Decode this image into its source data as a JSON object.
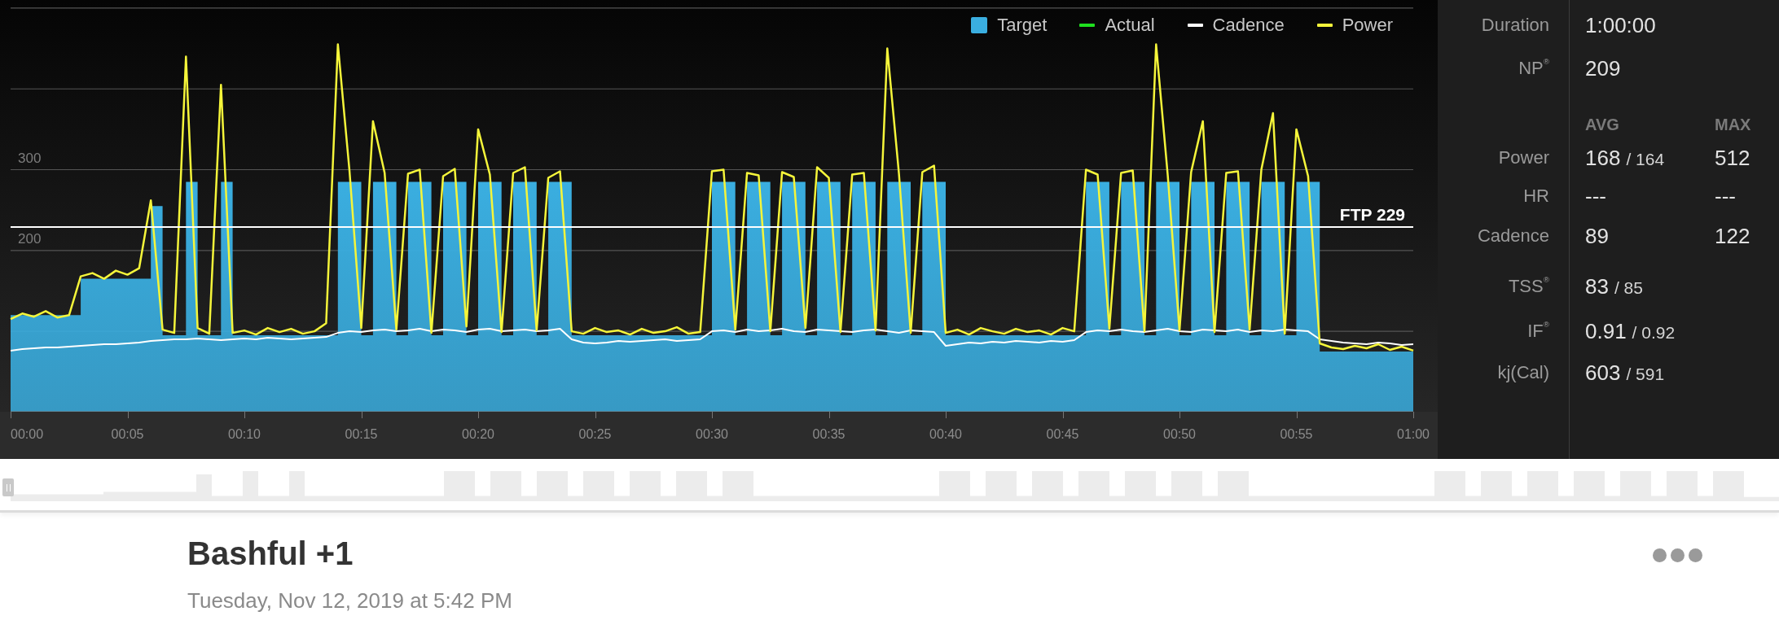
{
  "chart": {
    "chart_data": {
      "type": "area",
      "legend": "upper right",
      "ylim": [
        -58,
        510
      ],
      "xlim": [
        0,
        60
      ],
      "yticks": [
        200,
        300
      ],
      "xticks": [
        {
          "value": 0,
          "label": "00:00"
        },
        {
          "value": 5,
          "label": "00:05"
        },
        {
          "value": 10,
          "label": "00:10"
        },
        {
          "value": 15,
          "label": "00:15"
        },
        {
          "value": 20,
          "label": "00:20"
        },
        {
          "value": 25,
          "label": "00:25"
        },
        {
          "value": 30,
          "label": "00:30"
        },
        {
          "value": 35,
          "label": "00:35"
        },
        {
          "value": 40,
          "label": "00:40"
        },
        {
          "value": 45,
          "label": "00:45"
        },
        {
          "value": 50,
          "label": "00:50"
        },
        {
          "value": 55,
          "label": "00:55"
        },
        {
          "value": 60,
          "label": "01:00"
        }
      ],
      "x": [
        0,
        0.5,
        1,
        1.5,
        2,
        2.5,
        3,
        3.5,
        4,
        4.5,
        5,
        5.5,
        6,
        6.5,
        7,
        7.5,
        8,
        8.5,
        9,
        9.5,
        10,
        10.5,
        11,
        11.5,
        12,
        12.5,
        13,
        13.5,
        14,
        14.5,
        15,
        15.5,
        16,
        16.5,
        17,
        17.5,
        18,
        18.5,
        19,
        19.5,
        20,
        20.5,
        21,
        21.5,
        22,
        22.5,
        23,
        23.5,
        24,
        24.5,
        25,
        25.5,
        26,
        26.5,
        27,
        27.5,
        28,
        28.5,
        29,
        29.5,
        30,
        30.5,
        31,
        31.5,
        32,
        32.5,
        33,
        33.5,
        34,
        34.5,
        35,
        35.5,
        36,
        36.5,
        37,
        37.5,
        38,
        38.5,
        39,
        39.5,
        40,
        40.5,
        41,
        41.5,
        42,
        42.5,
        43,
        43.5,
        44,
        44.5,
        45,
        45.5,
        46,
        46.5,
        47,
        47.5,
        48,
        48.5,
        49,
        49.5,
        50,
        50.5,
        51,
        51.5,
        52,
        52.5,
        53,
        53.5,
        54,
        54.5,
        55,
        55.5,
        56,
        56.5,
        57,
        57.5,
        58,
        58.5,
        59,
        59.5,
        60
      ],
      "series": [
        {
          "name": "Target",
          "color": "#3aaee0",
          "values": [
            120,
            120,
            120,
            120,
            120,
            120,
            165,
            165,
            165,
            165,
            165,
            165,
            255,
            95,
            95,
            285,
            95,
            95,
            285,
            95,
            95,
            95,
            95,
            95,
            95,
            95,
            95,
            95,
            285,
            285,
            95,
            285,
            285,
            95,
            285,
            285,
            95,
            285,
            285,
            95,
            285,
            285,
            95,
            285,
            285,
            95,
            285,
            285,
            95,
            95,
            95,
            95,
            95,
            95,
            95,
            95,
            95,
            95,
            95,
            95,
            285,
            285,
            95,
            285,
            285,
            95,
            285,
            285,
            95,
            285,
            285,
            95,
            285,
            285,
            95,
            285,
            285,
            95,
            285,
            285,
            95,
            95,
            95,
            95,
            95,
            95,
            95,
            95,
            95,
            95,
            95,
            95,
            285,
            285,
            95,
            285,
            285,
            95,
            285,
            285,
            95,
            285,
            285,
            95,
            285,
            285,
            95,
            285,
            285,
            95,
            285,
            285,
            75,
            75,
            75,
            75,
            75,
            75,
            75,
            75,
            75
          ]
        },
        {
          "name": "Actual",
          "color": "#1fe01f",
          "type": "line",
          "values": [
            null,
            null,
            null,
            null,
            null,
            null,
            null,
            null,
            null,
            null,
            null,
            null,
            null,
            null,
            null,
            null,
            null,
            null,
            null,
            null,
            null,
            null,
            null,
            null,
            null,
            null,
            null,
            null,
            null,
            null,
            null,
            null,
            null,
            null,
            null,
            null,
            null,
            null,
            null,
            null,
            null,
            null,
            null,
            null,
            null,
            null,
            null,
            null,
            null,
            null,
            null,
            null,
            null,
            null,
            null,
            null,
            null,
            null,
            null,
            null,
            null,
            null,
            null,
            null,
            null,
            null,
            null,
            null,
            null,
            null,
            null,
            null,
            null,
            null,
            null,
            null,
            null,
            null,
            null,
            null,
            null,
            null,
            null,
            null,
            null,
            null,
            null,
            null,
            null,
            null,
            null,
            null,
            null,
            null,
            null,
            null,
            null,
            null,
            null,
            null,
            null,
            null,
            null,
            null,
            null,
            null,
            null,
            null,
            null,
            null,
            null,
            null,
            null,
            null,
            null,
            null,
            null,
            null,
            null,
            null,
            null
          ]
        },
        {
          "name": "Cadence",
          "color": "#ffffff",
          "type": "line",
          "values": [
            76,
            78,
            79,
            80,
            80,
            81,
            82,
            83,
            84,
            84,
            85,
            86,
            88,
            89,
            90,
            90,
            91,
            90,
            89,
            90,
            91,
            90,
            92,
            91,
            90,
            91,
            92,
            93,
            98,
            100,
            99,
            101,
            102,
            100,
            101,
            103,
            100,
            102,
            101,
            99,
            102,
            103,
            100,
            101,
            102,
            100,
            101,
            103,
            90,
            86,
            85,
            86,
            88,
            87,
            88,
            89,
            90,
            88,
            89,
            90,
            100,
            101,
            99,
            102,
            100,
            101,
            103,
            100,
            99,
            102,
            101,
            100,
            99,
            101,
            102,
            100,
            98,
            101,
            100,
            99,
            82,
            84,
            86,
            85,
            87,
            86,
            88,
            87,
            86,
            88,
            87,
            89,
            99,
            101,
            100,
            102,
            100,
            99,
            101,
            103,
            100,
            99,
            102,
            101,
            100,
            102,
            99,
            101,
            100,
            102,
            101,
            100,
            90,
            88,
            86,
            85,
            84,
            86,
            85,
            83,
            84
          ]
        },
        {
          "name": "Power",
          "color": "#f5f53a",
          "type": "line",
          "values": [
            115,
            122,
            118,
            125,
            117,
            120,
            168,
            172,
            165,
            175,
            170,
            178,
            262,
            102,
            98,
            440,
            104,
            97,
            405,
            98,
            101,
            96,
            104,
            99,
            103,
            97,
            100,
            110,
            455,
            298,
            104,
            360,
            296,
            102,
            295,
            300,
            98,
            292,
            301,
            106,
            350,
            294,
            99,
            296,
            303,
            101,
            290,
            298,
            100,
            97,
            104,
            99,
            101,
            96,
            103,
            98,
            100,
            105,
            97,
            99,
            298,
            300,
            102,
            296,
            293,
            100,
            297,
            291,
            104,
            303,
            290,
            99,
            294,
            296,
            101,
            450,
            295,
            98,
            297,
            305,
            98,
            102,
            96,
            104,
            100,
            97,
            103,
            99,
            101,
            96,
            104,
            100,
            300,
            294,
            103,
            296,
            299,
            100,
            455,
            293,
            101,
            297,
            360,
            99,
            296,
            298,
            102,
            300,
            370,
            97,
            350,
            292,
            85,
            80,
            78,
            82,
            79,
            84,
            77,
            81,
            76
          ]
        }
      ],
      "ref_lines": [
        {
          "axis": "y",
          "value": 229,
          "label": "FTP 229"
        }
      ]
    }
  },
  "stats": {
    "summary": [
      {
        "label": "Duration",
        "value": "1:00:00"
      },
      {
        "label": "NP$^{®}$",
        "value": "209"
      }
    ],
    "columns": [
      "AVG",
      "MAX"
    ],
    "metrics": [
      {
        "label": "Power",
        "avg": "168",
        "avg_alt": "/ 164",
        "max": "512"
      },
      {
        "label": "HR",
        "avg": "---",
        "max": "---"
      },
      {
        "label": "Cadence",
        "avg": "89",
        "max": "122"
      }
    ],
    "totals": [
      {
        "label": "TSS$^{®}$",
        "avg": "83",
        "avg_alt": "/ 85"
      },
      {
        "label": "IF$^{®}$",
        "avg": "0.91",
        "avg_alt": "/ 0.92"
      },
      {
        "label": "kj(Cal)",
        "avg": "603",
        "avg_alt": "/ 591"
      }
    ]
  },
  "workout": {
    "title": "Bashful +1",
    "date": "Tuesday, Nov 12, 2019 at 5:42 PM"
  }
}
